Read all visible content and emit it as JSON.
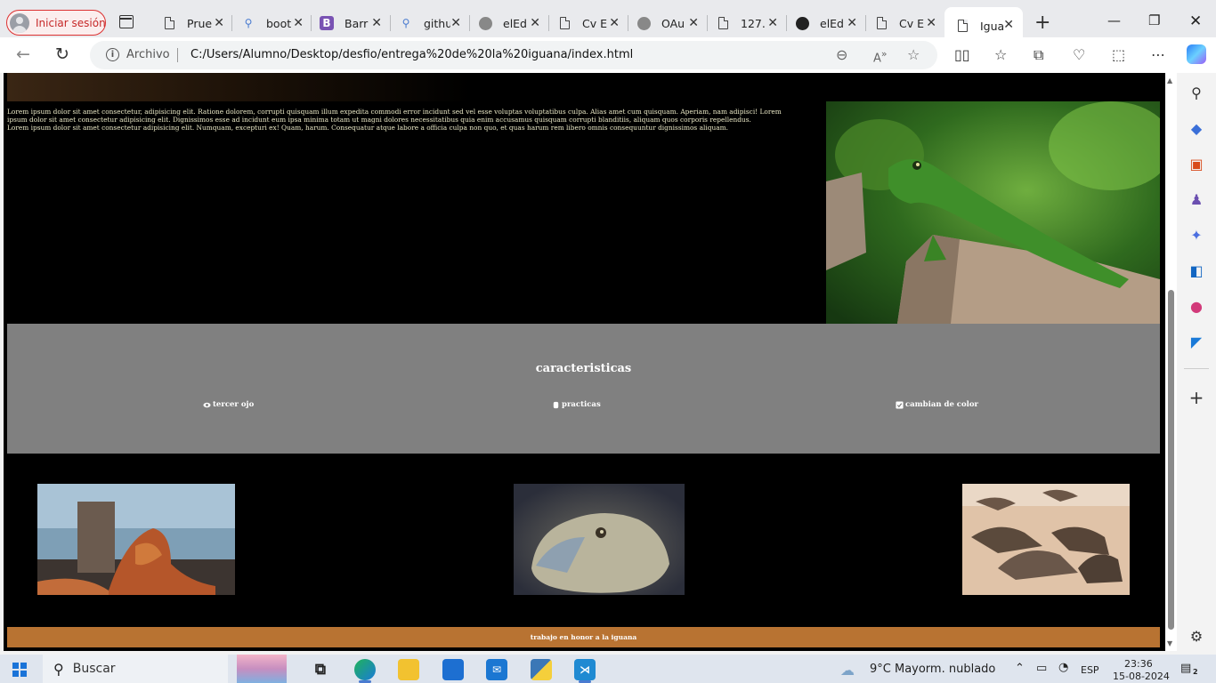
{
  "browser": {
    "profile_label": "Iniciar sesión",
    "tabs": [
      {
        "title": "Prue",
        "favicon": "doc-icon"
      },
      {
        "title": "boot",
        "favicon": "search-icon"
      },
      {
        "title": "Barr",
        "favicon": "bootstrap-icon"
      },
      {
        "title": "githu",
        "favicon": "search-icon"
      },
      {
        "title": "elEd",
        "favicon": "github-icon"
      },
      {
        "title": "Cv E",
        "favicon": "doc-icon"
      },
      {
        "title": "OAu",
        "favicon": "github-icon"
      },
      {
        "title": "127.",
        "favicon": "doc-icon"
      },
      {
        "title": "elEd",
        "favicon": "github-icon"
      },
      {
        "title": "Cv E",
        "favicon": "doc-icon"
      },
      {
        "title": "Igua",
        "favicon": "doc-icon",
        "active": true
      }
    ],
    "address": {
      "protocol_label": "Archivo",
      "url": "C:/Users/Alumno/Desktop/desfio/entrega%20de%20la%20iguana/index.html"
    }
  },
  "page": {
    "intro_text": "Lorem ipsum dolor sit amet consectetur, adipisicing elit. Ratione dolorem, corrupti quisquam illum expedita commodi error incidunt sed vel esse voluptas voluptatibus culpa. Alias amet cum quisquam. Aperiam, nam adipisci! Lorem ipsum dolor sit amet consectetur adipisicing elit. Dignissimos esse ad incidunt eum ipsa minima totam ut magni dolores necessitatibus quia enim accusamus quisquam corrupti blanditiis, aliquam quos corporis repellendus.",
    "intro_text_2": "Lorem ipsum dolor sit amet consectetur adipisicing elit. Numquam, excepturi ex! Quam, harum. Consequatur atque labore a officia culpa non quo, et quas harum rem libero omnis consequuntur dignissimos aliquam.",
    "features": {
      "title": "caracteristicas",
      "items": [
        {
          "label": "tercer ojo",
          "icon": "eye-icon"
        },
        {
          "label": "practicas",
          "icon": "hand-icon"
        },
        {
          "label": "cambian de color",
          "icon": "check-square-icon"
        }
      ]
    },
    "footer": "trabajo en honor a la iguana"
  },
  "taskbar": {
    "search_placeholder": "Buscar",
    "weather": "9°C  Mayorm. nublado",
    "language": "ESP",
    "time": "23:36",
    "date": "15-08-2024",
    "notification_count": "2"
  },
  "colors": {
    "features_bg": "#808080",
    "footer_bg": "#b87332",
    "profile_accent": "#c62828"
  }
}
